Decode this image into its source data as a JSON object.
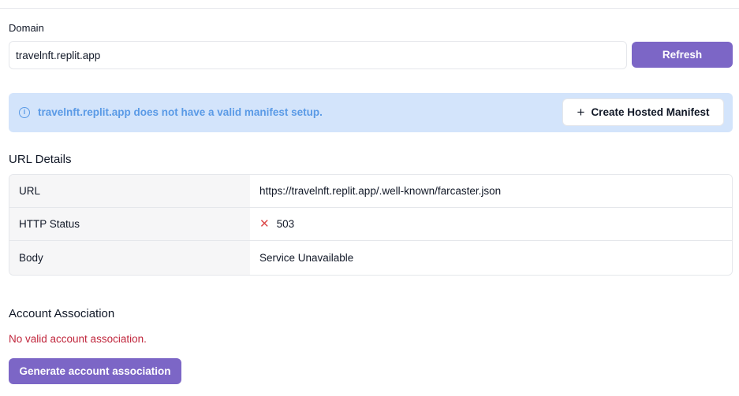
{
  "domain": {
    "label": "Domain",
    "value": "travelnft.replit.app",
    "refresh_label": "Refresh"
  },
  "alert": {
    "icon": "info-icon",
    "message": "travelnft.replit.app does not have a valid manifest setup.",
    "action_label": "Create Hosted Manifest",
    "action_icon": "plus-icon"
  },
  "url_details": {
    "title": "URL Details",
    "rows": [
      {
        "key": "URL",
        "value": "https://travelnft.replit.app/.well-known/farcaster.json"
      },
      {
        "key": "HTTP Status",
        "value": "503",
        "status_icon": "x-icon"
      },
      {
        "key": "Body",
        "value": "Service Unavailable"
      }
    ]
  },
  "account_association": {
    "title": "Account Association",
    "error": "No valid account association.",
    "button_label": "Generate account association"
  },
  "colors": {
    "accent": "#7c66c6",
    "alert_bg": "#d3e4fb",
    "alert_text": "#5a9ae6",
    "error": "#c0263c"
  }
}
